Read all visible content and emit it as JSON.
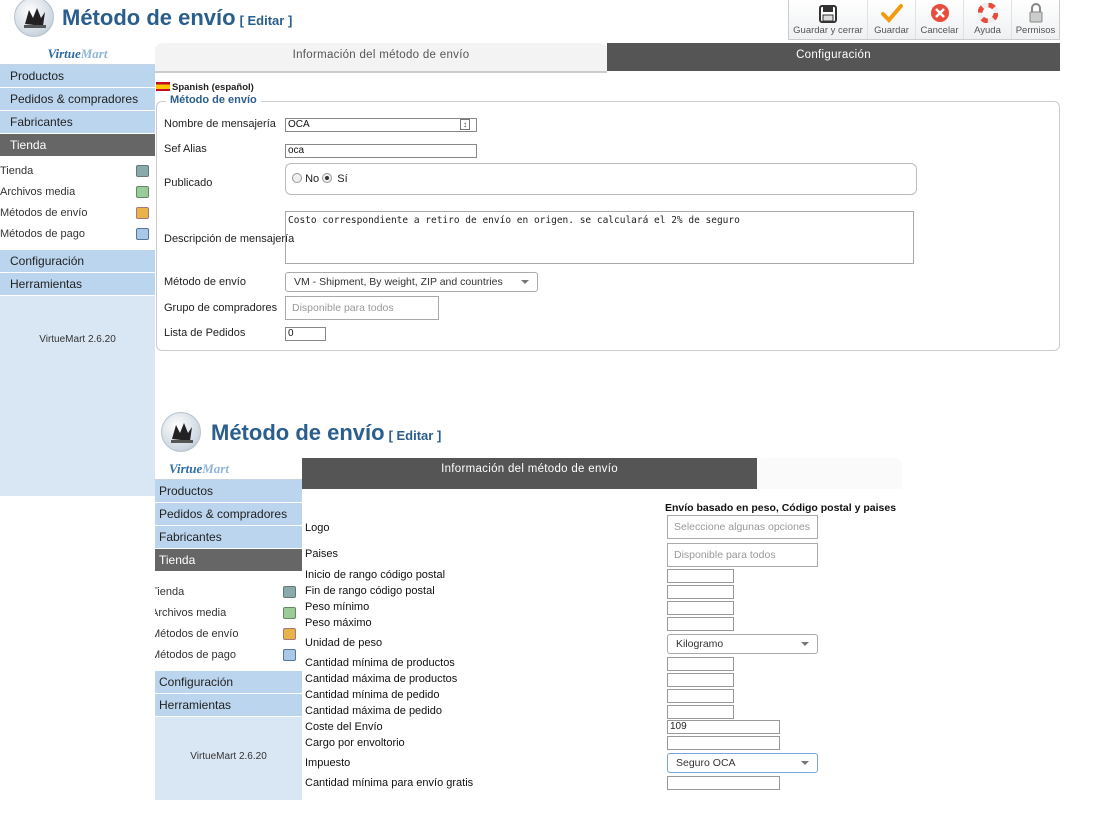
{
  "header": {
    "title": "Método de envío",
    "edit_label": "[ Editar ]"
  },
  "toolbar": {
    "buttons": [
      {
        "label": "Guardar y cerrar",
        "icon": "save-icon"
      },
      {
        "label": "Guardar",
        "icon": "checkmark-icon"
      },
      {
        "label": "Cancelar",
        "icon": "cancel-icon"
      },
      {
        "label": "Ayuda",
        "icon": "lifebuoy-icon"
      },
      {
        "label": "Permisos",
        "icon": "lock-icon"
      }
    ]
  },
  "sidebar": {
    "logo": {
      "part1": "Virtue",
      "part2": "Mart"
    },
    "items_top": [
      "Productos",
      "Pedidos & compradores",
      "Fabricantes",
      "Tienda"
    ],
    "active": "Tienda",
    "subitems": [
      "Tienda",
      "Archivos media",
      "Métodos de envío",
      "Métodos de pago"
    ],
    "items_bottom": [
      "Configuración",
      "Herramientas"
    ],
    "version": "VirtueMart 2.6.20"
  },
  "tabs": {
    "info": "Información del método de envío",
    "config": "Configuración"
  },
  "form": {
    "language": "Spanish (español)",
    "legend": "Método de envío",
    "fields": {
      "nombre": {
        "label": "Nombre de mensajería",
        "value": "OCA"
      },
      "sef": {
        "label": "Sef Alias",
        "value": "oca"
      },
      "publicado": {
        "label": "Publicado",
        "no": "No",
        "si": "Sí",
        "selected": "Sí"
      },
      "descripcion": {
        "label": "Descripción de mensajería",
        "value": "Costo correspondiente a retiro de envío en origen. se calculará el 2% de seguro"
      },
      "metodo": {
        "label": "Método de envío",
        "value": "VM - Shipment, By weight, ZIP and countries"
      },
      "grupo": {
        "label": "Grupo de compradores",
        "placeholder": "Disponible para todos"
      },
      "lista": {
        "label": "Lista de Pedidos",
        "value": "0"
      }
    }
  },
  "config": {
    "heading": "Envío basado en peso, Código postal y paises",
    "logo": {
      "label": "Logo",
      "placeholder": "Seleccione algunas opciones"
    },
    "paises": {
      "label": "Paises",
      "placeholder": "Disponible para todos"
    },
    "zip_start": {
      "label": "Inicio de rango código postal",
      "value": ""
    },
    "zip_end": {
      "label": "Fin de rango código postal",
      "value": ""
    },
    "peso_min": {
      "label": "Peso mínimo",
      "value": ""
    },
    "peso_max": {
      "label": "Peso máximo",
      "value": ""
    },
    "unidad_peso": {
      "label": "Unidad de peso",
      "value": "Kilogramo"
    },
    "cant_min_prod": {
      "label": "Cantidad mínima de productos",
      "value": ""
    },
    "cant_max_prod": {
      "label": "Cantidad máxima de productos",
      "value": ""
    },
    "cant_min_ped": {
      "label": "Cantidad mínima de pedido",
      "value": ""
    },
    "cant_max_ped": {
      "label": "Cantidad máxima de pedido",
      "value": ""
    },
    "coste_envio": {
      "label": "Coste del Envío",
      "value": "109"
    },
    "cargo_envoltorio": {
      "label": "Cargo por envoltorio",
      "value": ""
    },
    "impuesto": {
      "label": "Impuesto",
      "value": "Seguro OCA"
    },
    "cant_min_gratis": {
      "label": "Cantidad mínima para envío gratis",
      "value": ""
    }
  }
}
